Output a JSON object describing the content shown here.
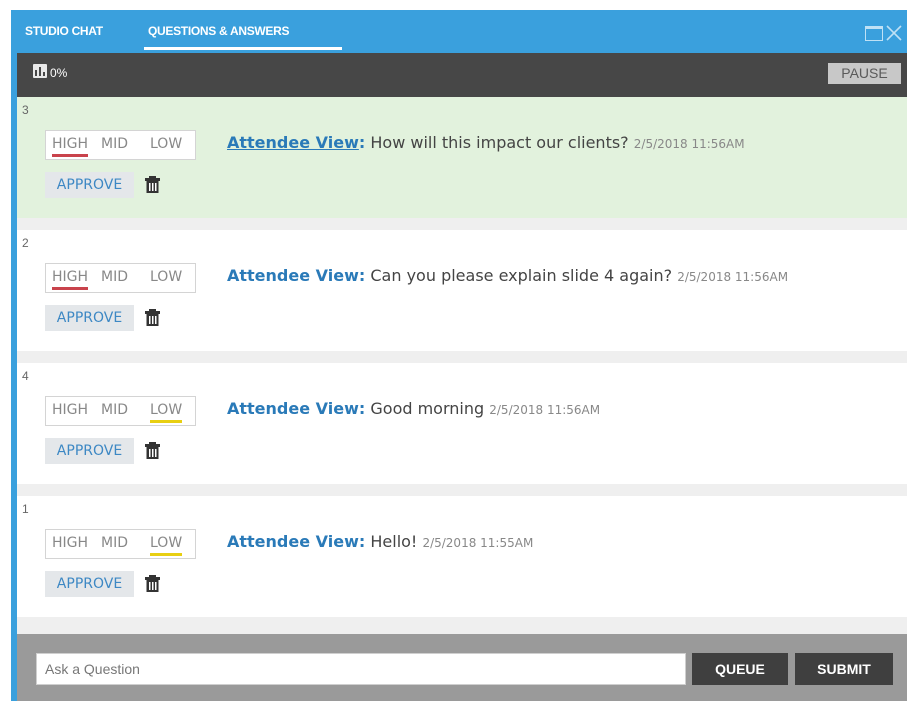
{
  "tabs": {
    "studio_chat": "STUDIO CHAT",
    "questions_answers": "QUESTIONS & ANSWERS"
  },
  "toolbar": {
    "stat_value": "0%",
    "pause_label": "PAUSE"
  },
  "questions": [
    {
      "number": "3",
      "priority": "HIGH",
      "author": "Attendee View",
      "text": "How will this impact our clients?",
      "time": "2/5/2018 11:56AM",
      "highlighted": true
    },
    {
      "number": "2",
      "priority": "HIGH",
      "author": "Attendee View",
      "text": "Can you please explain slide 4 again?",
      "time": "2/5/2018 11:56AM",
      "highlighted": false
    },
    {
      "number": "4",
      "priority": "LOW",
      "author": "Attendee View",
      "text": "Good morning",
      "time": "2/5/2018 11:56AM",
      "highlighted": false
    },
    {
      "number": "1",
      "priority": "LOW",
      "author": "Attendee View",
      "text": "Hello!",
      "time": "2/5/2018 11:55AM",
      "highlighted": false
    }
  ],
  "priority_labels": {
    "high": "HIGH",
    "mid": "MID",
    "low": "LOW"
  },
  "approve_label": "APPROVE",
  "author_suffix": ":",
  "bottom": {
    "placeholder": "Ask a Question",
    "queue_label": "QUEUE",
    "submit_label": "SUBMIT"
  },
  "colors": {
    "frame_accent": "#3aa0dd",
    "highlight_row": "#e2f2dd",
    "priority_high": "#c9434c",
    "priority_low": "#e8cf12",
    "author_link": "#2a7ab8"
  },
  "icons": {
    "maximize": "maximize-icon",
    "close": "close-icon",
    "stats": "bar-chart-icon",
    "delete": "trash-icon"
  }
}
